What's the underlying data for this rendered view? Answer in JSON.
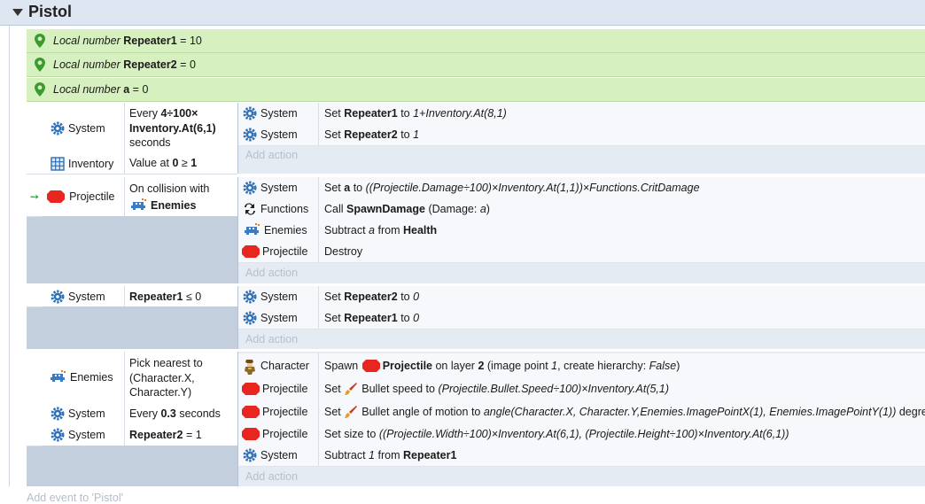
{
  "group": {
    "title": "Pistol"
  },
  "locals": [
    {
      "label": "Local number",
      "name": "Repeater1",
      "op": "=",
      "value": "10"
    },
    {
      "label": "Local number",
      "name": "Repeater2",
      "op": "=",
      "value": "0"
    },
    {
      "label": "Local number",
      "name": "a",
      "op": "=",
      "value": "0"
    }
  ],
  "objects": {
    "system": "System",
    "inventory": "Inventory",
    "projectile": "Projectile",
    "functions": "Functions",
    "enemies": "Enemies",
    "character": "Character"
  },
  "add_action_label": "Add action",
  "add_event_label": "Add event to 'Pistol'",
  "event1": {
    "cond1": {
      "every": "Every",
      "expr1": "4÷100×",
      "expr2": "Inventory.At(6,1)",
      "unit": "seconds"
    },
    "cond2": {
      "prefix": "Value at",
      "a": "0",
      "op": "≥",
      "b": "1"
    },
    "actions": [
      {
        "verb": "Set",
        "var": "Repeater1",
        "to": "to",
        "expr": "1+Inventory.At(8,1)"
      },
      {
        "verb": "Set",
        "var": "Repeater2",
        "to": "to",
        "expr": "1"
      }
    ]
  },
  "event2": {
    "cond": {
      "line1": "On collision with",
      "target": "Enemies"
    },
    "actions": [
      {
        "verb": "Set",
        "var": "a",
        "to": "to",
        "expr": "((Projectile.Damage÷100)×Inventory.At(1,1))×Functions.CritDamage"
      },
      {
        "verb": "Call",
        "fn": "SpawnDamage",
        "paren_open": "(Damage:",
        "param": "a",
        "paren_close": ")"
      },
      {
        "verb": "Subtract",
        "param": "a",
        "from": "from",
        "target": "Health"
      },
      {
        "verb": "Destroy"
      }
    ]
  },
  "event3": {
    "cond": {
      "var": "Repeater1",
      "op": "≤",
      "value": "0"
    },
    "actions": [
      {
        "verb": "Set",
        "var": "Repeater2",
        "to": "to",
        "expr": "0"
      },
      {
        "verb": "Set",
        "var": "Repeater1",
        "to": "to",
        "expr": "0"
      }
    ]
  },
  "event4": {
    "cond1": {
      "line1": "Pick nearest to",
      "line2": "(Character.X,",
      "line3": "Character.Y)"
    },
    "cond2": {
      "prefix": "Every",
      "value": "0.3",
      "unit": "seconds"
    },
    "cond3": {
      "var": "Repeater2",
      "op": "=",
      "value": "1"
    },
    "actions": [
      {
        "pre": "Spawn",
        "obj": "Projectile",
        "mid": "on layer",
        "layer": "2",
        "rest_open": "(image point",
        "point": "1",
        "rest_mid": ", create hierarchy:",
        "hier": "False",
        "rest_close": ")"
      },
      {
        "verb": "Set",
        "prop": "Bullet speed to",
        "expr": "(Projectile.Bullet.Speed÷100)×Inventory.At(5,1)"
      },
      {
        "verb": "Set",
        "prop": "Bullet angle of motion to",
        "expr": "angle(Character.X, Character.Y,Enemies.ImagePointX(1), Enemies.ImagePointY(1))",
        "tail": "degre"
      },
      {
        "verb": "Set size to",
        "expr": "((Projectile.Width÷100)×Inventory.At(6,1), (Projectile.Height÷100)×Inventory.At(6,1))"
      },
      {
        "verb": "Subtract",
        "amount": "1",
        "from": "from",
        "target": "Repeater1"
      }
    ]
  },
  "colors": {
    "header": "#dde6f1",
    "local": "#d7f0bf",
    "event_bg": "#c3cfdd",
    "action_bg": "#f6f8fb",
    "projectile": "#e8251f"
  },
  "icons": [
    "pin-icon",
    "gear-icon",
    "grid-icon",
    "red-blob-icon",
    "arrows-icon",
    "invader-icon",
    "character-icon",
    "brush-icon",
    "arrow-right-icon",
    "triangle-down-icon"
  ]
}
